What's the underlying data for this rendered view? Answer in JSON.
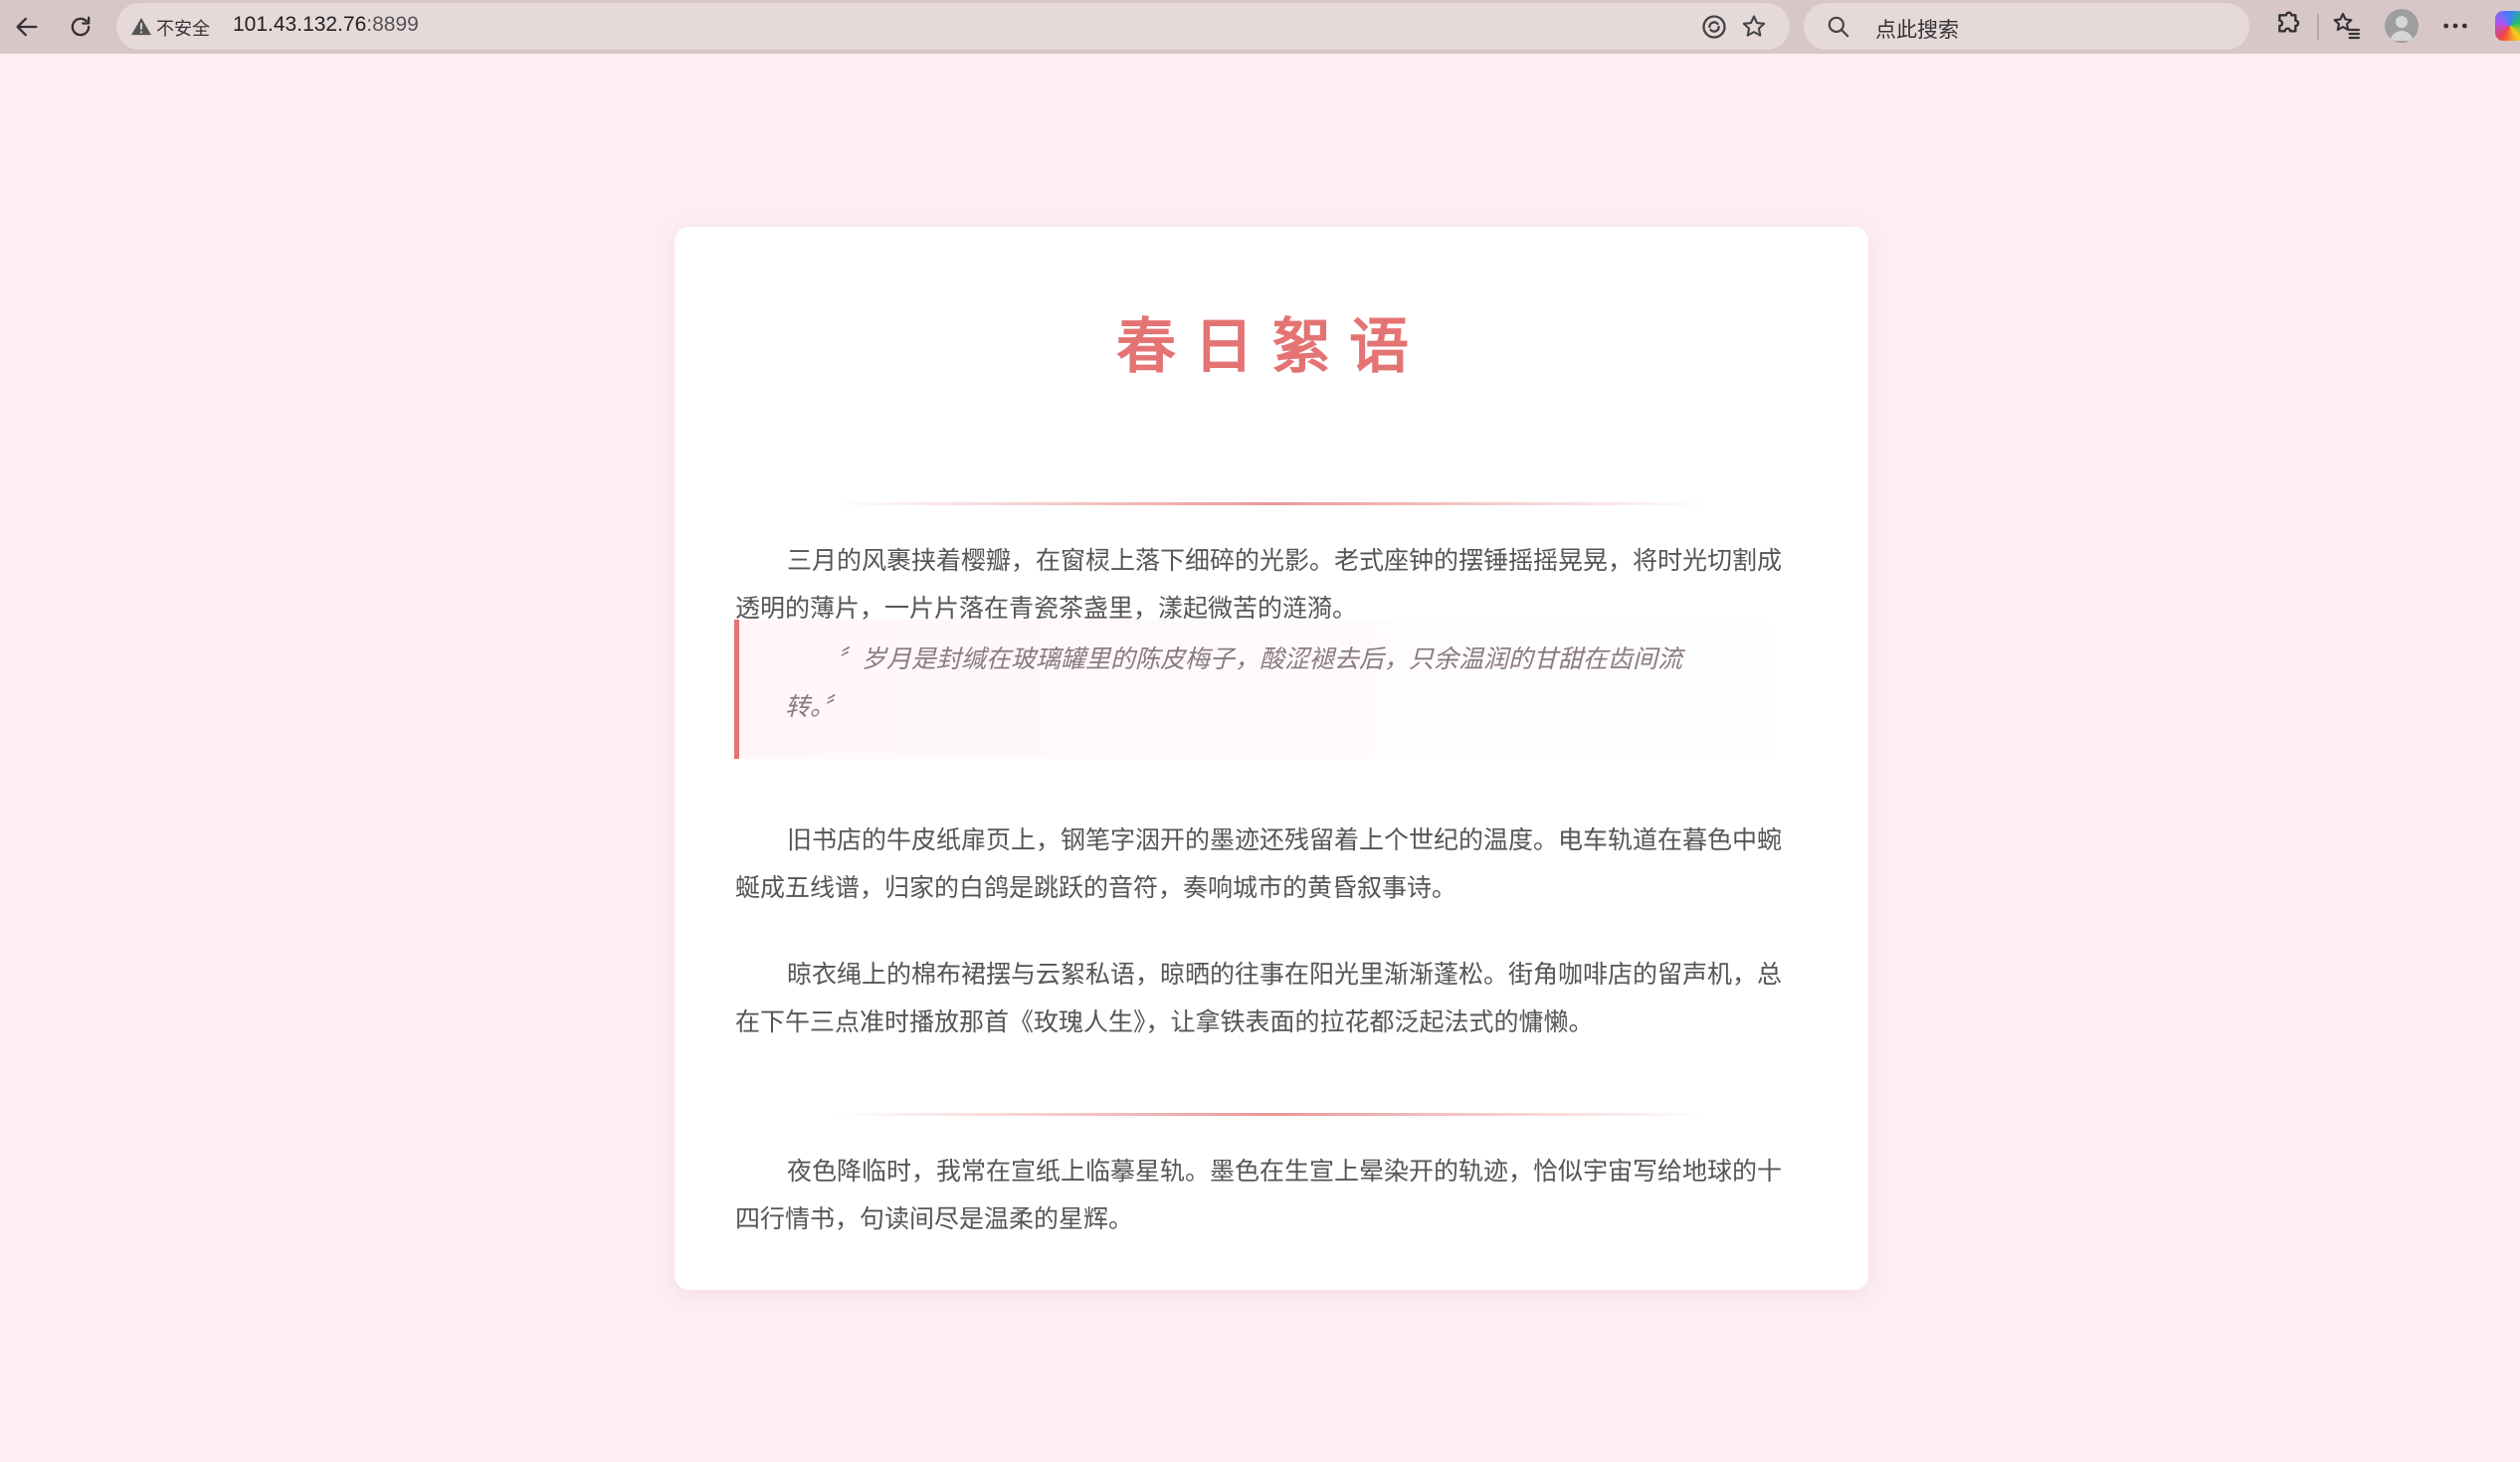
{
  "browser": {
    "insecure_label": "不安全",
    "url_host": "101.43.132.76",
    "url_port": ":8899",
    "search_placeholder": "点此搜索"
  },
  "article": {
    "title": "春日絮语",
    "paragraphs": [
      "三月的风裹挟着樱瓣，在窗棂上落下细碎的光影。老式座钟的摆锤摇摇晃晃，将时光切割成透明的薄片，一片片落在青瓷茶盏里，漾起微苦的涟漪。",
      "旧书店的牛皮纸扉页上，钢笔字洇开的墨迹还残留着上个世纪的温度。电车轨道在暮色中蜿蜒成五线谱，归家的白鸽是跳跃的音符，奏响城市的黄昏叙事诗。",
      "晾衣绳上的棉布裙摆与云絮私语，晾晒的往事在阳光里渐渐蓬松。街角咖啡店的留声机，总在下午三点准时播放那首《玫瑰人生》，让拿铁表面的拉花都泛起法式的慵懒。",
      "夜色降临时，我常在宣纸上临摹星轨。墨色在生宣上晕染开的轨迹，恰似宇宙写给地球的十四行情书，句读间尽是温柔的星辉。"
    ],
    "quote": "〞岁月是封缄在玻璃罐里的陈皮梅子，酸涩褪去后，只余温润的甘甜在齿间流转。〞"
  },
  "colors": {
    "accent": "#e47474",
    "page_background": "#fdeef3",
    "card_background": "#ffffff",
    "body_text": "#555555"
  }
}
